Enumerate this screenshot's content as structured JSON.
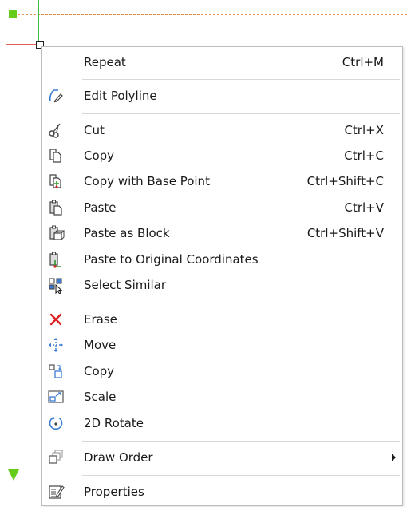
{
  "colors": {
    "grip_green": "#66cc1a",
    "dash_orange": "#e0904a",
    "erase_red": "#e02020",
    "icon_blue": "#3a7bd5"
  },
  "menu": {
    "items": [
      {
        "label": "Repeat",
        "shortcut": "Ctrl+M",
        "icon": ""
      },
      {
        "label": "Edit Polyline",
        "shortcut": "",
        "icon": "edit-polyline-icon"
      },
      {
        "label": "Cut",
        "shortcut": "Ctrl+X",
        "icon": "scissors-icon"
      },
      {
        "label": "Copy",
        "shortcut": "Ctrl+C",
        "icon": "copy-icon"
      },
      {
        "label": "Copy with Base Point",
        "shortcut": "Ctrl+Shift+C",
        "icon": "copy-base-point-icon"
      },
      {
        "label": "Paste",
        "shortcut": "Ctrl+V",
        "icon": "paste-icon"
      },
      {
        "label": "Paste as Block",
        "shortcut": "Ctrl+Shift+V",
        "icon": "paste-block-icon"
      },
      {
        "label": "Paste to Original Coordinates",
        "shortcut": "",
        "icon": "paste-original-icon"
      },
      {
        "label": "Select Similar",
        "shortcut": "",
        "icon": "select-similar-icon"
      },
      {
        "label": "Erase",
        "shortcut": "",
        "icon": "erase-icon"
      },
      {
        "label": "Move",
        "shortcut": "",
        "icon": "move-icon"
      },
      {
        "label": "Copy",
        "shortcut": "",
        "icon": "copy-object-icon"
      },
      {
        "label": "Scale",
        "shortcut": "",
        "icon": "scale-icon"
      },
      {
        "label": "2D Rotate",
        "shortcut": "",
        "icon": "rotate-icon"
      },
      {
        "label": "Draw Order",
        "shortcut": "",
        "icon": "draw-order-icon",
        "submenu": true
      },
      {
        "label": "Properties",
        "shortcut": "",
        "icon": "properties-icon"
      }
    ]
  }
}
